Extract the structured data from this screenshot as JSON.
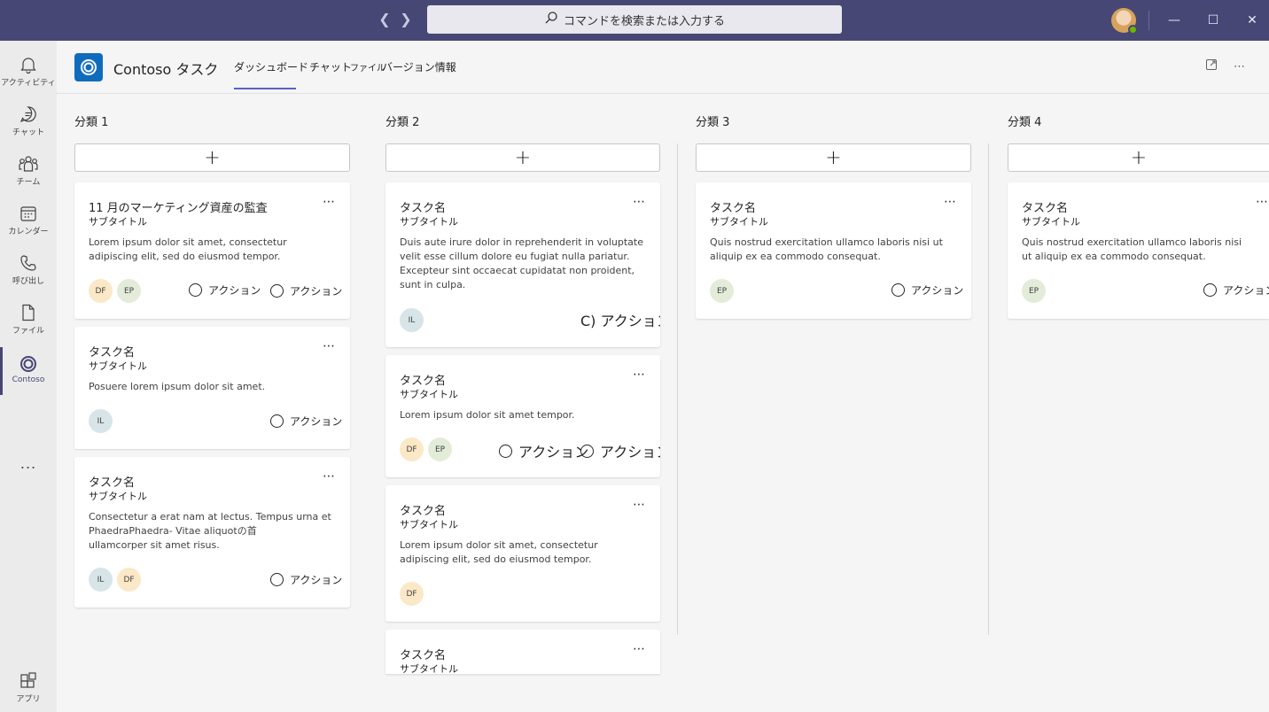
{
  "titlebar": {
    "search_placeholder": "コマンドを検索または入力する",
    "back_icon": "chevron-left-icon",
    "forward_icon": "chevron-right-icon"
  },
  "rail": {
    "items": [
      {
        "label": "アクティビティ",
        "icon": "bell-icon"
      },
      {
        "label": "チャット",
        "icon": "chat-icon"
      },
      {
        "label": "チーム",
        "icon": "teams-icon"
      },
      {
        "label": "カレンダー",
        "icon": "calendar-icon"
      },
      {
        "label": "呼び出し",
        "icon": "phone-icon"
      },
      {
        "label": "ファイル",
        "icon": "file-icon"
      },
      {
        "label": "Contoso",
        "icon": "contoso-icon"
      }
    ],
    "more": "...",
    "apps_label": "アプリ"
  },
  "app": {
    "title": "Contoso タスク",
    "tabs": [
      "ダッシュボード",
      "チャット",
      "ファイル",
      "バージョン情報"
    ]
  },
  "columns": [
    {
      "title": "分類 1"
    },
    {
      "title": "分類 2"
    },
    {
      "title": "分類 3"
    },
    {
      "title": "分類 4"
    }
  ],
  "cards": {
    "c1a": {
      "title": "11 月のマーケティング資産の監査",
      "subtitle": "サブタイトル",
      "body": "Lorem ipsum dolor sit amet, consectetur adipiscing elit, sed do eiusmod tempor.",
      "avatars": [
        "DF",
        "EP"
      ],
      "actions": [
        "アクション",
        "アクション"
      ]
    },
    "c1b": {
      "title": "タスク名",
      "subtitle": "サブタイトル",
      "body": "Posuere lorem ipsum dolor sit amet.",
      "avatars": [
        "IL"
      ],
      "actions": [
        "アクション"
      ]
    },
    "c1c": {
      "title": "タスク名",
      "subtitle": "サブタイトル",
      "body_line1": "Consectetur a erat nam at lectus. Tempus urna et",
      "body_line2": "PhaedraPhaedra- Vitae aliquotの首",
      "body_line3": "ullamcorper sit amet risus.",
      "avatars": [
        "IL",
        "DF"
      ],
      "actions": [
        "アクション"
      ]
    },
    "c2a": {
      "title": "タスク名",
      "subtitle": "サブタイトル",
      "body": "Duis aute irure dolor in reprehenderit in voluptate velit esse cillum dolore eu fugiat nulla pariatur. Excepteur sint occaecat cupidatat non proident, sunt in culpa.",
      "avatars": [
        "IL"
      ],
      "action_text": "C) アクション"
    },
    "c2b": {
      "title": "タスク名",
      "subtitle": "サブタイトル",
      "body": "Lorem ipsum dolor sit amet tempor.",
      "avatars": [
        "DF",
        "EP"
      ],
      "actions": [
        "アクション",
        "アクション"
      ]
    },
    "c2c": {
      "title": "タスク名",
      "subtitle": "サブタイトル",
      "body": "Lorem ipsum dolor sit amet, consectetur adipiscing elit, sed do eiusmod tempor.",
      "avatars": [
        "DF"
      ]
    },
    "c2d": {
      "title": "タスク名",
      "subtitle": "サブタイトル"
    },
    "c3a": {
      "title": "タスク名",
      "subtitle": "サブタイトル",
      "body": "Quis nostrud exercitation ullamco laboris nisi ut aliquip ex ea commodo consequat.",
      "avatars": [
        "EP"
      ],
      "actions": [
        "アクション"
      ]
    },
    "c4a": {
      "title": "タスク名",
      "subtitle": "サブタイトル",
      "body": "Quis nostrud exercitation ullamco laboris nisi ut aliquip ex ea commodo consequat.",
      "avatars": [
        "EP"
      ],
      "actions": [
        "アクション"
      ]
    }
  },
  "colors": {
    "titlebar": "#464775",
    "accent": "#5b5fc7",
    "logo": "#0f6cbd"
  }
}
